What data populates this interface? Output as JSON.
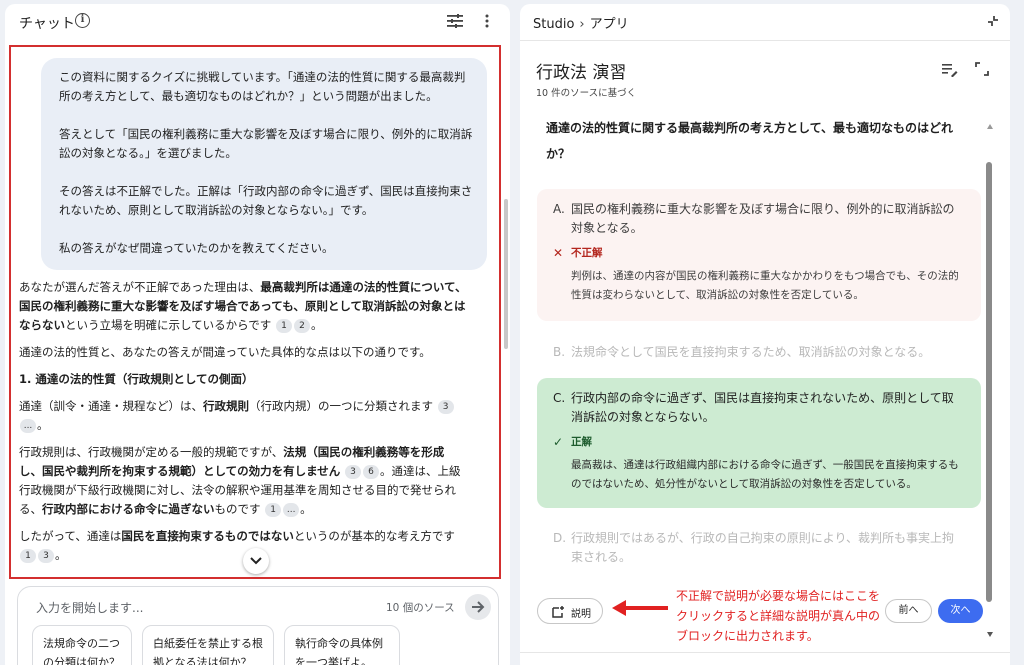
{
  "chat": {
    "title": "チャット",
    "user_message": [
      "この資料に関するクイズに挑戦しています。「通達の法的性質に関する最高裁判所の考え方として、最も適切なものはどれか？」という問題が出ました。",
      "答えとして「国民の権利義務に重大な影響を及ぼす場合に限り、例外的に取消訴訟の対象となる。」を選びました。",
      "その答えは不正解でした。正解は「行政内部の命令に過ぎず、国民は直接拘束されないため、原則として取消訴訟の対象とならない。」です。",
      "私の答えがなぜ間違っていたのかを教えてください。"
    ],
    "answer": {
      "p1_a": "あなたが選んだ答えが不正解であった理由は、",
      "p1_b": "最高裁判所は通達の法的性質について、国民の権利義務に重大な影響を及ぼす場合であっても、原則として取消訴訟の対象とはならない",
      "p1_c": "という立場を明確に示しているからです",
      "p1_cites": [
        "1",
        "2"
      ],
      "p2": "通達の法的性質と、あなたの答えが間違っていた具体的な点は以下の通りです。",
      "h1": "1. 通達の法的性質（行政規則としての側面）",
      "p3_a": "通達（訓令・通達・規程など）は、",
      "p3_b": "行政規則",
      "p3_c": "（行政内規）の一つに分類されます",
      "p3_cites": [
        "3",
        "..."
      ],
      "p4_a": "行政規則は、行政機関が定める一般的規範ですが、",
      "p4_b": "法規（国民の権利義務等を形成し、国民や裁判所を拘束する規範）としての効力を有しません",
      "p4_cites": [
        "3",
        "6"
      ],
      "p4_c": "。通達は、上級行政機関が下級行政機関に対し、法令の解釈や運用基準を周知させる目的で発せられる、",
      "p4_d": "行政内部における命令に過ぎない",
      "p4_e": "ものです",
      "p4_cites2": [
        "1",
        "..."
      ],
      "p5_a": "したがって、通達は",
      "p5_b": "国民を直接拘束するものではない",
      "p5_c": "というのが基本的な考え方です",
      "p5_cites": [
        "1",
        "3"
      ]
    },
    "input": {
      "placeholder": "入力を開始します...",
      "source_count": "10 個のソース"
    },
    "suggestions": [
      "法規命令の二つの分類は何か？",
      "白紙委任を禁止する根拠となる法は何か？",
      "執行命令の具体例を一つ挙げよ。"
    ]
  },
  "studio": {
    "breadcrumb_root": "Studio",
    "breadcrumb_current": "アプリ",
    "title": "行政法 演習",
    "subtitle": "10 件のソースに基づく",
    "question": "通達の法的性質に関する最高裁判所の考え方として、最も適切なものはどれか？",
    "options": [
      {
        "letter": "A.",
        "text": "国民の権利義務に重大な影響を及ぼす場合に限り、例外的に取消訴訟の対象となる。",
        "state": "incorrect",
        "verdict": "不正解",
        "explanation": "判例は、通達の内容が国民の権利義務に重大なかかわりをもつ場合でも、その法的性質は変わらないとして、取消訴訟の対象性を否定している。"
      },
      {
        "letter": "B.",
        "text": "法規命令として国民を直接拘束するため、取消訴訟の対象となる。",
        "state": "faded"
      },
      {
        "letter": "C.",
        "text": "行政内部の命令に過ぎず、国民は直接拘束されないため、原則として取消訴訟の対象とならない。",
        "state": "correct",
        "verdict": "正解",
        "explanation": "最高裁は、通達は行政組織内部における命令に過ぎず、一般国民を直接拘束するものではないため、処分性がないとして取消訴訟の対象性を否定している。"
      },
      {
        "letter": "D.",
        "text": "行政規則ではあるが、行政の自己拘束の原則により、裁判所も事実上拘束される。",
        "state": "faded"
      }
    ],
    "explain_label": "説明",
    "prev_label": "前へ",
    "next_label": "次へ"
  },
  "annotation": {
    "text": "不正解で説明が必要な場合にはここをクリックすると詳細な説明が真ん中のブロックに出力されます。",
    "color": "#e12121"
  },
  "colors": {
    "highlight_frame": "#d32f2f",
    "user_bubble": "#e9eef6",
    "incorrect_bg": "#fcf3f2",
    "correct_bg": "#cdebd2",
    "next_button": "#3d6cf0"
  }
}
